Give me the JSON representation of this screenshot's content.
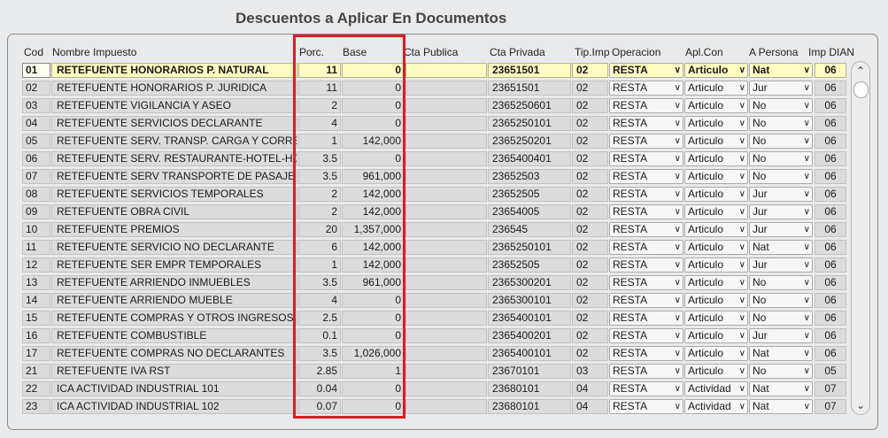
{
  "title": "Descuentos a Aplicar En Documentos",
  "headers": {
    "cod": "Cod",
    "nombre": "Nombre Impuesto",
    "porc": "Porc.",
    "base": "Base",
    "cta_publica": "Cta Publica",
    "cta_privada": "Cta Privada",
    "tip_imp": "Tip.Imp",
    "operacion": "Operacion",
    "apl_con": "Apl.Con",
    "a_persona": "A Persona",
    "imp_dian": "Imp DIAN"
  },
  "selected_row": 0,
  "highlight_color": "#e01b24",
  "selected_row_color": "#fffcc2",
  "rows": [
    {
      "cod": "01",
      "nombre": "RETEFUENTE HONORARIOS P. NATURAL",
      "porc": "11",
      "base": "0",
      "cta_publica": "",
      "cta_privada": "23651501",
      "tip": "02",
      "operacion": "RESTA",
      "apl_con": "Articulo",
      "persona": "Nat",
      "dian": "06"
    },
    {
      "cod": "02",
      "nombre": "RETEFUENTE HONORARIOS P. JURIDICA",
      "porc": "11",
      "base": "0",
      "cta_publica": "",
      "cta_privada": "23651501",
      "tip": "02",
      "operacion": "RESTA",
      "apl_con": "Articulo",
      "persona": "Jur",
      "dian": "06"
    },
    {
      "cod": "03",
      "nombre": "RETEFUENTE VIGILANCIA Y ASEO",
      "porc": "2",
      "base": "0",
      "cta_publica": "",
      "cta_privada": "2365250601",
      "tip": "02",
      "operacion": "RESTA",
      "apl_con": "Articulo",
      "persona": "No",
      "dian": "06"
    },
    {
      "cod": "04",
      "nombre": "RETEFUENTE SERVICIOS DECLARANTE",
      "porc": "4",
      "base": "0",
      "cta_publica": "",
      "cta_privada": "2365250101",
      "tip": "02",
      "operacion": "RESTA",
      "apl_con": "Articulo",
      "persona": "No",
      "dian": "06"
    },
    {
      "cod": "05",
      "nombre": "RETEFUENTE SERV. TRANSP. CARGA Y CORRE",
      "porc": "1",
      "base": "142,000",
      "cta_publica": "",
      "cta_privada": "2365250201",
      "tip": "02",
      "operacion": "RESTA",
      "apl_con": "Articulo",
      "persona": "No",
      "dian": "06"
    },
    {
      "cod": "06",
      "nombre": "RETEFUENTE SERV. RESTAURANTE-HOTEL-HO",
      "porc": "3.5",
      "base": "0",
      "cta_publica": "",
      "cta_privada": "2365400401",
      "tip": "02",
      "operacion": "RESTA",
      "apl_con": "Articulo",
      "persona": "No",
      "dian": "06"
    },
    {
      "cod": "07",
      "nombre": "RETEFUENTE SERV TRANSPORTE DE PASAJE",
      "porc": "3.5",
      "base": "961,000",
      "cta_publica": "",
      "cta_privada": "23652503",
      "tip": "02",
      "operacion": "RESTA",
      "apl_con": "Articulo",
      "persona": "No",
      "dian": "06"
    },
    {
      "cod": "08",
      "nombre": "RETEFUENTE SERVICIOS TEMPORALES",
      "porc": "2",
      "base": "142,000",
      "cta_publica": "",
      "cta_privada": "23652505",
      "tip": "02",
      "operacion": "RESTA",
      "apl_con": "Articulo",
      "persona": "Jur",
      "dian": "06"
    },
    {
      "cod": "09",
      "nombre": "RETEFUENTE OBRA CIVIL",
      "porc": "2",
      "base": "142,000",
      "cta_publica": "",
      "cta_privada": "23654005",
      "tip": "02",
      "operacion": "RESTA",
      "apl_con": "Articulo",
      "persona": "Jur",
      "dian": "06"
    },
    {
      "cod": "10",
      "nombre": "RETEFUENTE PREMIOS",
      "porc": "20",
      "base": "1,357,000",
      "cta_publica": "",
      "cta_privada": "236545",
      "tip": "02",
      "operacion": "RESTA",
      "apl_con": "Articulo",
      "persona": "Jur",
      "dian": "06"
    },
    {
      "cod": "11",
      "nombre": "RETEFUENTE SERVICIO NO DECLARANTE",
      "porc": "6",
      "base": "142,000",
      "cta_publica": "",
      "cta_privada": "2365250101",
      "tip": "02",
      "operacion": "RESTA",
      "apl_con": "Articulo",
      "persona": "Nat",
      "dian": "06"
    },
    {
      "cod": "12",
      "nombre": "RETEFUENTE SER EMPR TEMPORALES",
      "porc": "1",
      "base": "142,000",
      "cta_publica": "",
      "cta_privada": "23652505",
      "tip": "02",
      "operacion": "RESTA",
      "apl_con": "Articulo",
      "persona": "Jur",
      "dian": "06"
    },
    {
      "cod": "13",
      "nombre": "RETEFUENTE ARRIENDO INMUEBLES",
      "porc": "3.5",
      "base": "961,000",
      "cta_publica": "",
      "cta_privada": "2365300201",
      "tip": "02",
      "operacion": "RESTA",
      "apl_con": "Articulo",
      "persona": "No",
      "dian": "06"
    },
    {
      "cod": "14",
      "nombre": "RETEFUENTE ARRIENDO MUEBLE",
      "porc": "4",
      "base": "0",
      "cta_publica": "",
      "cta_privada": "2365300101",
      "tip": "02",
      "operacion": "RESTA",
      "apl_con": "Articulo",
      "persona": "No",
      "dian": "06"
    },
    {
      "cod": "15",
      "nombre": "RETEFUENTE COMPRAS Y OTROS INGRESOS",
      "porc": "2.5",
      "base": "0",
      "cta_publica": "",
      "cta_privada": "2365400101",
      "tip": "02",
      "operacion": "RESTA",
      "apl_con": "Articulo",
      "persona": "No",
      "dian": "06"
    },
    {
      "cod": "16",
      "nombre": "RETEFUENTE COMBUSTIBLE",
      "porc": "0.1",
      "base": "0",
      "cta_publica": "",
      "cta_privada": "2365400201",
      "tip": "02",
      "operacion": "RESTA",
      "apl_con": "Articulo",
      "persona": "Jur",
      "dian": "06"
    },
    {
      "cod": "17",
      "nombre": "RETEFUENTE COMPRAS NO DECLARANTES",
      "porc": "3.5",
      "base": "1,026,000",
      "cta_publica": "",
      "cta_privada": "2365400101",
      "tip": "02",
      "operacion": "RESTA",
      "apl_con": "Articulo",
      "persona": "Nat",
      "dian": "06"
    },
    {
      "cod": "21",
      "nombre": "RETEFUENTE IVA  RST",
      "porc": "2.85",
      "base": "1",
      "cta_publica": "",
      "cta_privada": "23670101",
      "tip": "03",
      "operacion": "RESTA",
      "apl_con": "Articulo",
      "persona": "No",
      "dian": "05"
    },
    {
      "cod": "22",
      "nombre": "ICA ACTIVIDAD INDUSTRIAL 101",
      "porc": "0.04",
      "base": "0",
      "cta_publica": "",
      "cta_privada": "23680101",
      "tip": "04",
      "operacion": "RESTA",
      "apl_con": "Actividad",
      "persona": "Nat",
      "dian": "07"
    },
    {
      "cod": "23",
      "nombre": "ICA ACTIVIDAD INDUSTRIAL 102",
      "porc": "0.07",
      "base": "0",
      "cta_publica": "",
      "cta_privada": "23680101",
      "tip": "04",
      "operacion": "RESTA",
      "apl_con": "Actividad",
      "persona": "Nat",
      "dian": "07"
    }
  ],
  "icons": {
    "scroll_up": "chevron-up-icon",
    "scroll_down": "chevron-down-icon",
    "dropdown": "chevron-down-icon"
  }
}
